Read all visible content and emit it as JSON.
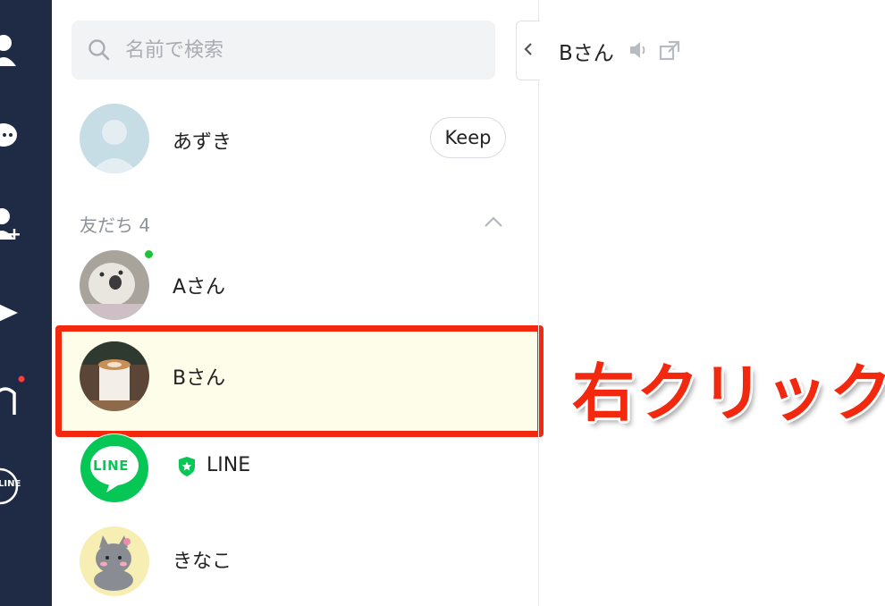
{
  "search": {
    "placeholder": "名前で検索"
  },
  "self_profile": {
    "name": "あずき",
    "keep_label": "Keep"
  },
  "friends_section": {
    "label": "友だち 4"
  },
  "friends": [
    {
      "name": "Aさん",
      "online": true
    },
    {
      "name": "Bさん",
      "selected": true
    },
    {
      "name": "LINE",
      "official": true,
      "logo_text": "LINE"
    },
    {
      "name": "きなこ"
    }
  ],
  "chat_header": {
    "title": "Bさん"
  },
  "rail": {
    "line_logo_text": "LINE"
  },
  "annotation": {
    "text": "右クリック"
  },
  "colors": {
    "rail": "#1f2a44",
    "accent_green": "#06c755",
    "highlight_border": "#f2290f",
    "highlight_fill": "#fefde9"
  }
}
